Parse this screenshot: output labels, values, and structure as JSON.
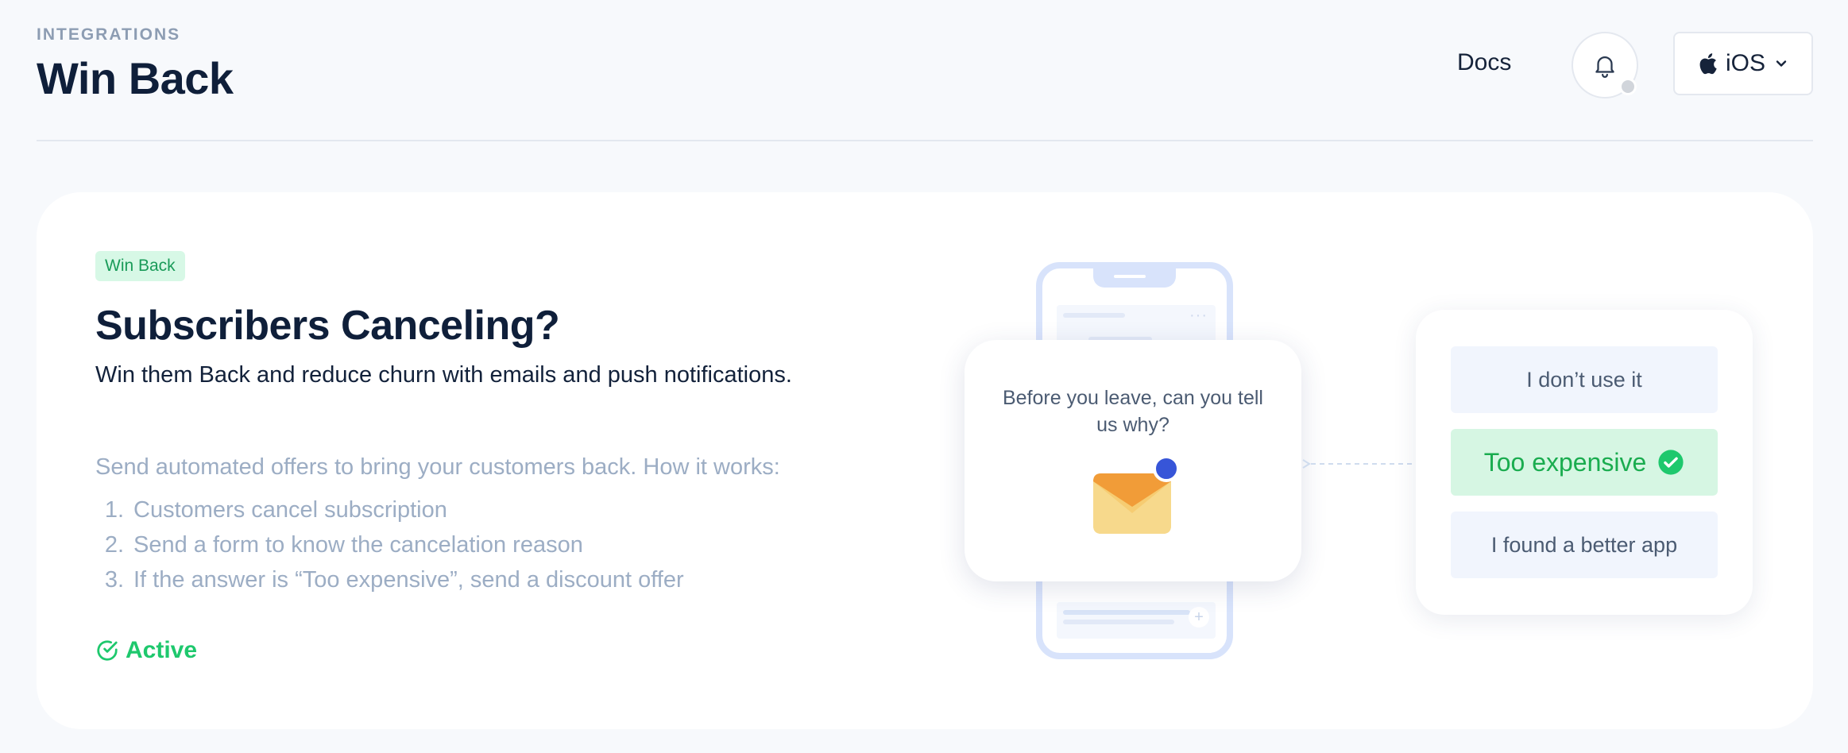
{
  "header": {
    "breadcrumb": "INTEGRATIONS",
    "title": "Win Back",
    "docs_label": "Docs",
    "platform": {
      "label": "iOS",
      "icon": "apple-icon"
    },
    "bell_icon": "bell-icon"
  },
  "card": {
    "badge": "Win Back",
    "title": "Subscribers Canceling?",
    "subtitle": "Win them Back and reduce churn with emails and push notifications.",
    "description": "Send automated offers to bring your customers back. How it works:",
    "steps": [
      {
        "num": "1.",
        "text": "Customers cancel subscription"
      },
      {
        "num": "2.",
        "text": "Send a form to know the cancelation reason"
      },
      {
        "num": "3.",
        "text": "If the answer is “Too expensive”, send a discount offer"
      }
    ],
    "status": "Active"
  },
  "illustration": {
    "popup_text": "Before you leave, can you tell us why?",
    "options": [
      {
        "label": "I don’t use it",
        "selected": false
      },
      {
        "label": "Too expensive",
        "selected": true
      },
      {
        "label": "I found a better app",
        "selected": false
      }
    ]
  },
  "colors": {
    "accent_green": "#1ec86d",
    "badge_bg": "#d7f8e6",
    "muted_text": "#9cadc4",
    "phone_outline": "#d8e3fb"
  }
}
